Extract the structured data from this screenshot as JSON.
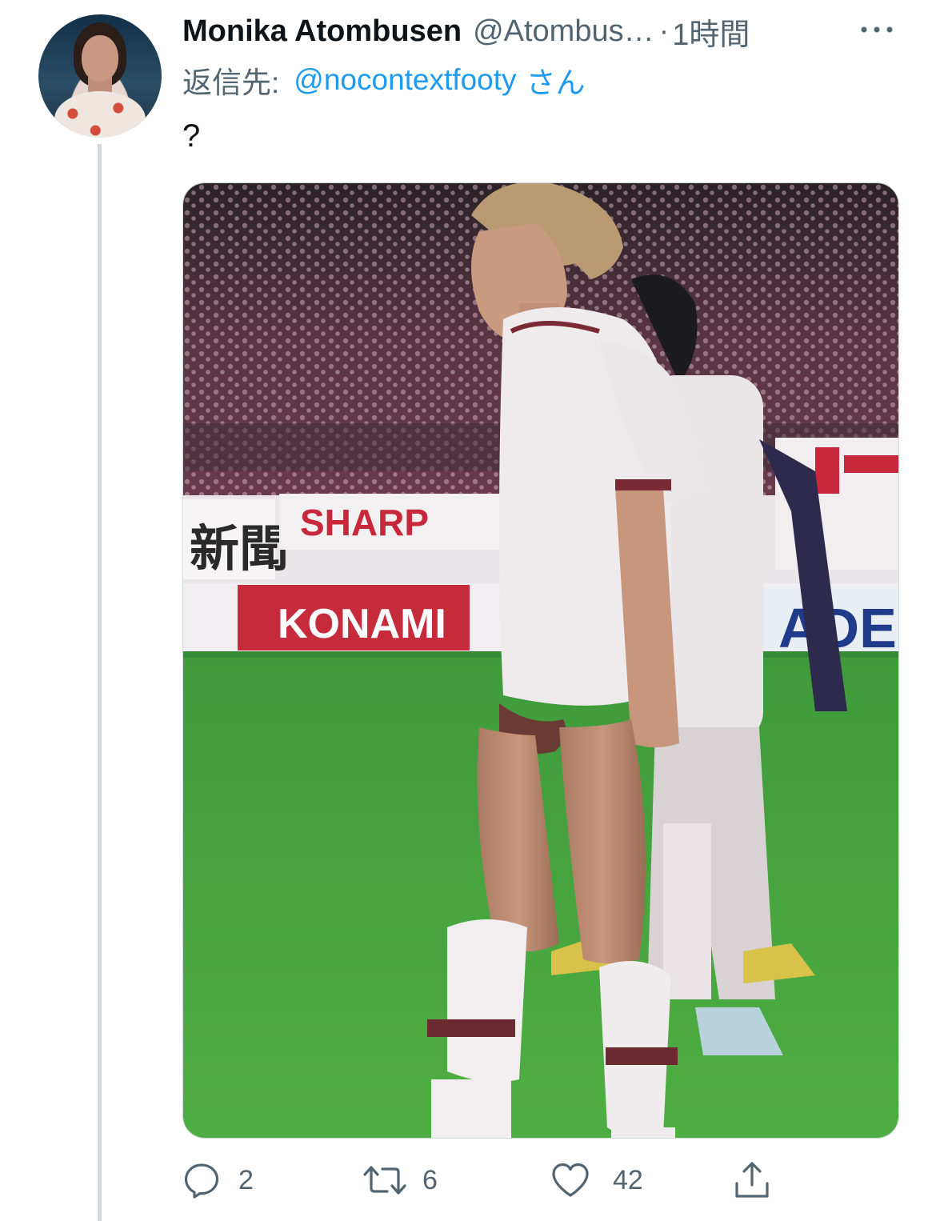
{
  "tweet": {
    "author": {
      "display_name": "Monika Atombusen",
      "handle": "@Atombus…",
      "separator": "·",
      "time": "1時間"
    },
    "reply_to": {
      "label": "返信先:",
      "mention": "@nocontextfooty",
      "suffix": "さん"
    },
    "text": "?",
    "media": {
      "type": "photo",
      "sign_texts": [
        "SHARP",
        "KONAMI",
        "新聞",
        "ADE"
      ]
    },
    "actions": {
      "reply_count": "2",
      "retweet_count": "6",
      "like_count": "42"
    }
  },
  "icons": {
    "more": "more-icon",
    "reply": "reply-icon",
    "retweet": "retweet-icon",
    "like": "like-icon",
    "share": "share-icon"
  },
  "colors": {
    "accent": "#1d9bf0",
    "secondary_text": "#536471",
    "thread_line": "#cfd9de"
  }
}
